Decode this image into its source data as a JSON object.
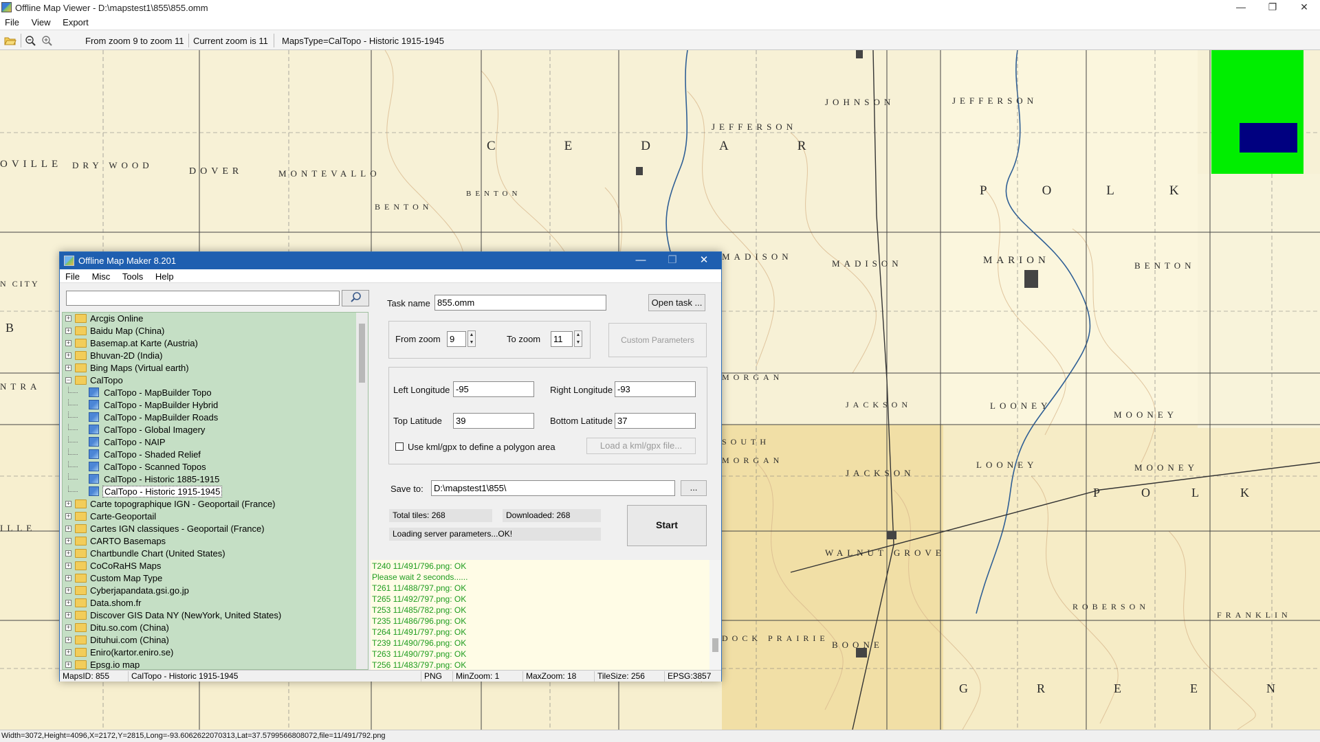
{
  "window": {
    "title": "Offline Map Viewer - D:\\mapstest1\\855\\855.omm",
    "minimize_glyph": "—",
    "maximize_glyph": "❐",
    "close_glyph": "✕"
  },
  "menu": [
    "File",
    "View",
    "Export"
  ],
  "toolbar": {
    "zoom_range_text": "From zoom 9 to zoom 11",
    "current_zoom_text": "Current zoom is 11",
    "maps_type_text": "MapsType=CalTopo - Historic 1915-1945",
    "icons": [
      "open-folder-icon",
      "zoom-out-icon",
      "zoom-in-icon"
    ]
  },
  "map": {
    "labels": [
      "OVILLE",
      "DRY WOOD",
      "DOVER",
      "MONTEVALLO",
      "BENTON",
      "BENTON",
      "CEDAR",
      "JEFFERSON",
      "JOHNSON",
      "JEFFERSON",
      "POLK",
      "MADISON",
      "MADISON",
      "MARION",
      "BENTON",
      "N CITY",
      "MORGAN",
      "JACKSON",
      "LOONEY",
      "MOONEY",
      "SOUTH",
      "MORGAN",
      "JACKSON",
      "LOONEY",
      "MOONEY",
      "POLK",
      "WALNUT GROVE",
      "ROBERSON",
      "FRANKLIN",
      "DOCK PRAIRIE",
      "BOONE",
      "GREENE",
      "NTRA",
      "ILLE",
      "B"
    ],
    "overview_colors": {
      "background": "#00ee00",
      "view": "#000080"
    }
  },
  "statusbar": {
    "text": "Width=3072,Height=4096,X=2172,Y=2815,Long=-93.6062622070313,Lat=37.5799566808072,file=11/491/792.png"
  },
  "dialog": {
    "title": "Offline Map Maker 8.201",
    "menu": [
      "File",
      "Misc",
      "Tools",
      "Help"
    ],
    "search": {
      "value": "",
      "button_glyph": "⌕"
    },
    "tree": [
      {
        "label": "Arcgis Online",
        "level": 0,
        "expander": "+"
      },
      {
        "label": "Baidu Map (China)",
        "level": 0,
        "expander": "+"
      },
      {
        "label": "Basemap.at Karte (Austria)",
        "level": 0,
        "expander": "+"
      },
      {
        "label": "Bhuvan-2D (India)",
        "level": 0,
        "expander": "+"
      },
      {
        "label": "Bing Maps (Virtual earth)",
        "level": 0,
        "expander": "+"
      },
      {
        "label": "CalTopo",
        "level": 0,
        "expander": "−"
      },
      {
        "label": "CalTopo - MapBuilder Topo",
        "level": 1
      },
      {
        "label": "CalTopo - MapBuilder Hybrid",
        "level": 1
      },
      {
        "label": "CalTopo - MapBuilder Roads",
        "level": 1
      },
      {
        "label": "CalTopo - Global Imagery",
        "level": 1
      },
      {
        "label": "CalTopo - NAIP",
        "level": 1
      },
      {
        "label": "CalTopo - Shaded Relief",
        "level": 1
      },
      {
        "label": "CalTopo - Scanned Topos",
        "level": 1
      },
      {
        "label": "CalTopo - Historic 1885-1915",
        "level": 1
      },
      {
        "label": "CalTopo - Historic 1915-1945",
        "level": 1,
        "selected": true
      },
      {
        "label": "Carte topographique IGN - Geoportail (France)",
        "level": 0,
        "expander": "+"
      },
      {
        "label": "Carte-Geoportail",
        "level": 0,
        "expander": "+"
      },
      {
        "label": "Cartes IGN classiques - Geoportail (France)",
        "level": 0,
        "expander": "+"
      },
      {
        "label": "CARTO Basemaps",
        "level": 0,
        "expander": "+"
      },
      {
        "label": "Chartbundle Chart (United States)",
        "level": 0,
        "expander": "+"
      },
      {
        "label": "CoCoRaHS Maps",
        "level": 0,
        "expander": "+"
      },
      {
        "label": "Custom Map Type",
        "level": 0,
        "expander": "+"
      },
      {
        "label": "Cyberjapandata.gsi.go.jp",
        "level": 0,
        "expander": "+"
      },
      {
        "label": "Data.shom.fr",
        "level": 0,
        "expander": "+"
      },
      {
        "label": "Discover GIS Data NY (NewYork, United States)",
        "level": 0,
        "expander": "+"
      },
      {
        "label": "Ditu.so.com (China)",
        "level": 0,
        "expander": "+"
      },
      {
        "label": "Dituhui.com (China)",
        "level": 0,
        "expander": "+"
      },
      {
        "label": "Eniro(kartor.eniro.se)",
        "level": 0,
        "expander": "+"
      },
      {
        "label": "Epsg.io map",
        "level": 0,
        "expander": "+"
      }
    ],
    "task_name_label": "Task name",
    "task_name_value": "855.omm",
    "open_task_button": "Open task ...",
    "from_zoom_label": "From zoom",
    "from_zoom_value": "9",
    "to_zoom_label": "To zoom",
    "to_zoom_value": "11",
    "custom_parameters_button": "Custom Parameters",
    "left_longitude_label": "Left Longitude",
    "left_longitude_value": "-95",
    "right_longitude_label": "Right Longitude",
    "right_longitude_value": "-93",
    "top_latitude_label": "Top Latitude",
    "top_latitude_value": "39",
    "bottom_latitude_label": "Bottom Latitude",
    "bottom_latitude_value": "37",
    "use_kml_label": "Use kml/gpx to define a polygon area",
    "load_kml_button": "Load a kml/gpx file...",
    "save_to_label": "Save to:",
    "save_to_value": "D:\\mapstest1\\855\\",
    "browse_button": "...",
    "total_tiles": "Total tiles: 268",
    "downloaded": "Downloaded: 268",
    "loading_status": "Loading server parameters...OK!",
    "start_button": "Start",
    "log": [
      "T240 11/491/796.png: OK",
      "Please wait 2 seconds......",
      "T261 11/488/797.png: OK",
      "T265 11/492/797.png: OK",
      "T253 11/485/782.png: OK",
      "T235 11/486/796.png: OK",
      "T264 11/491/797.png: OK",
      "T239 11/490/796.png: OK",
      "T263 11/490/797.png: OK",
      "T256 11/483/797.png: OK"
    ],
    "status": {
      "maps_id": "MapsID: 855",
      "maps_name": "CalTopo - Historic 1915-1945",
      "format": "PNG",
      "min_zoom": "MinZoom: 1",
      "max_zoom": "MaxZoom: 18",
      "tile_size": "TileSize: 256",
      "epsg": "EPSG:3857"
    }
  }
}
